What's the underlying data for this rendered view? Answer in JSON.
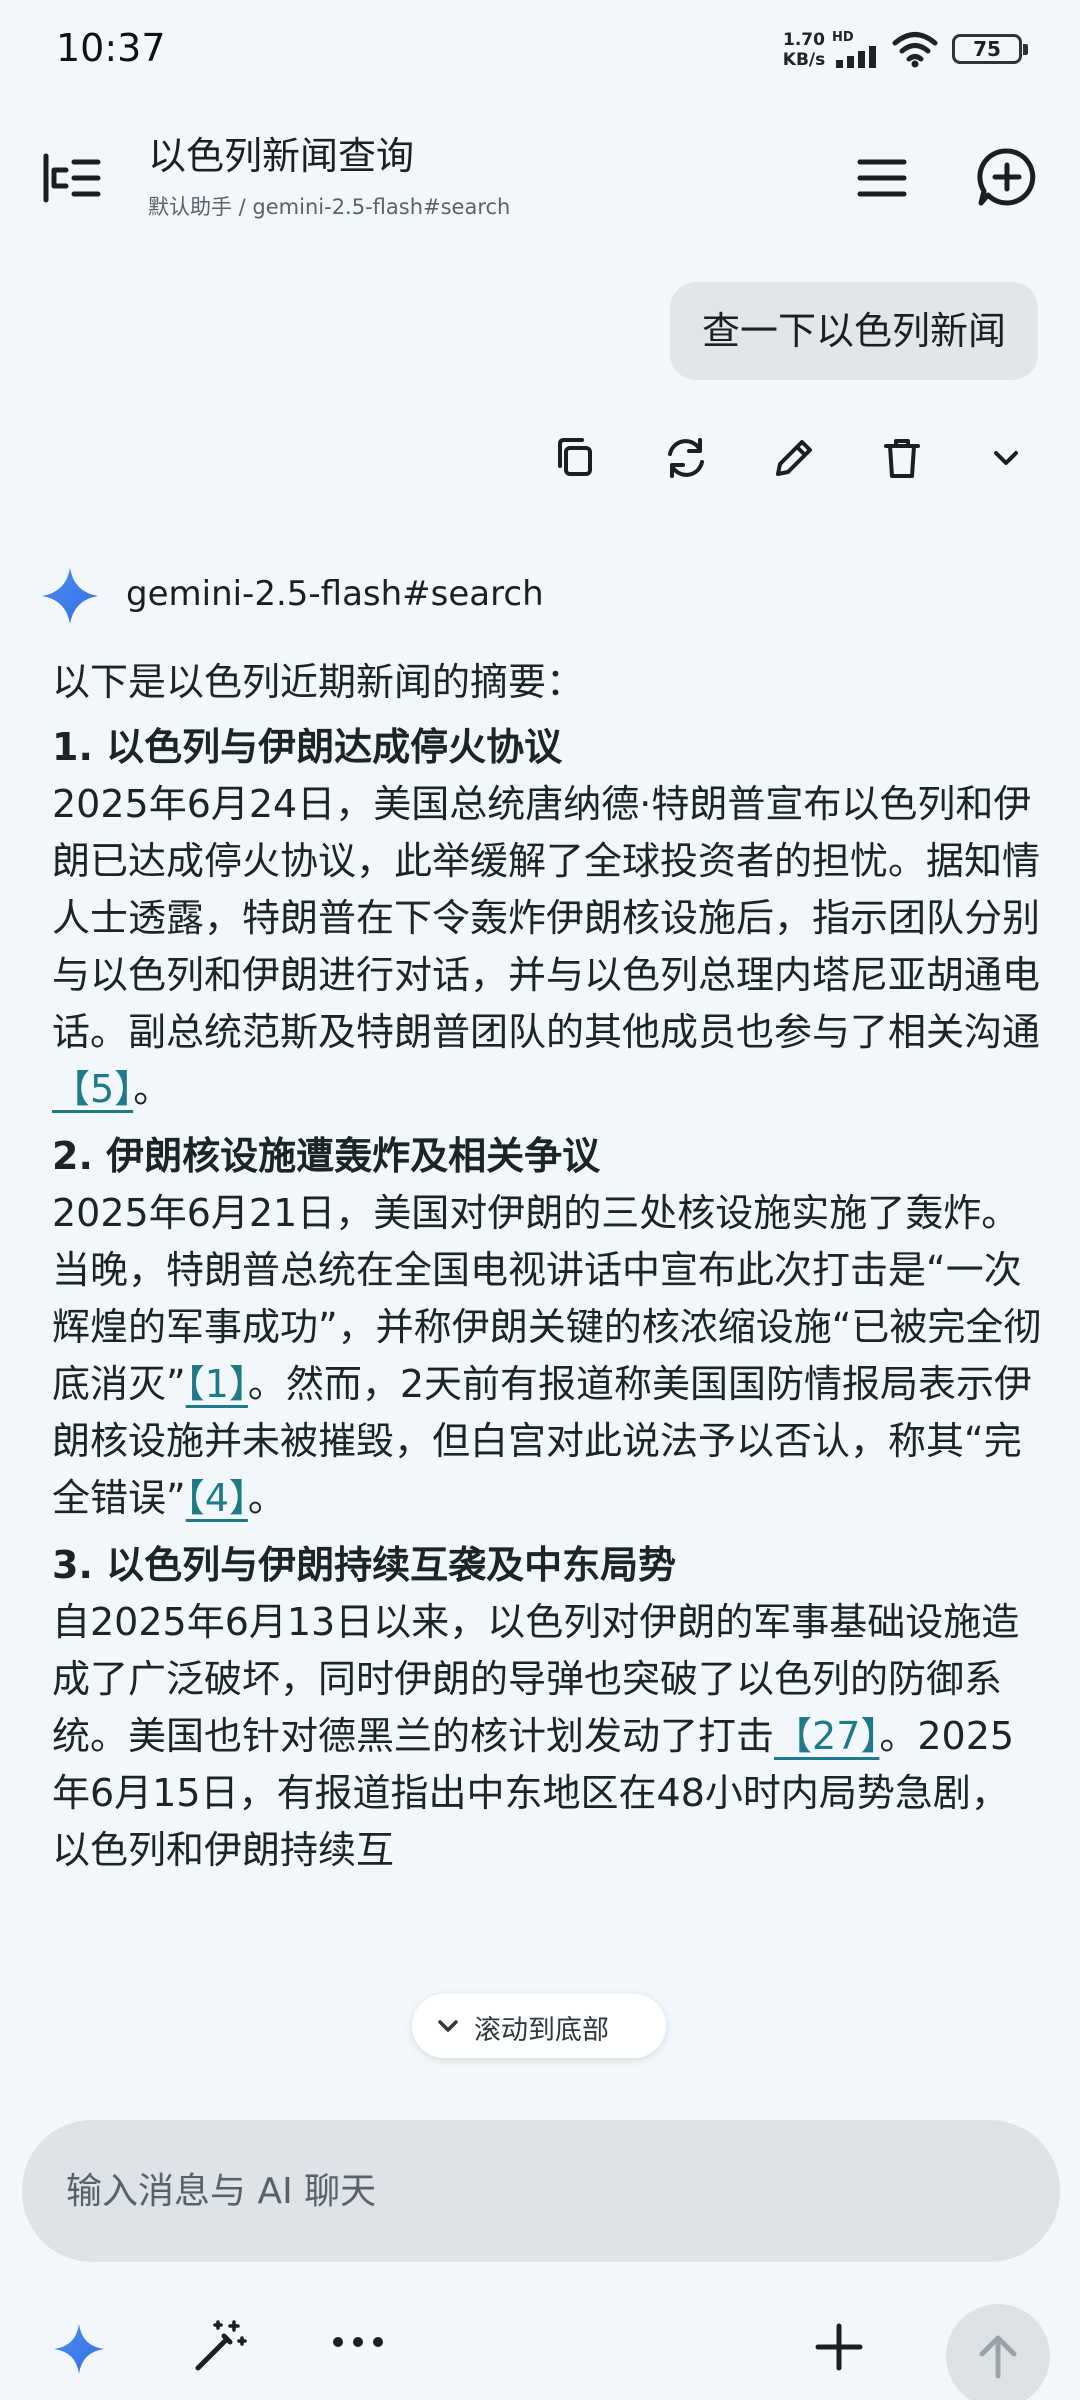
{
  "status_bar": {
    "time": "10:37",
    "net_speed_value": "1.70",
    "net_speed_unit": "KB/s",
    "hd_label": "HD",
    "battery": "75"
  },
  "header": {
    "title": "以色列新闻查询",
    "subtitle": "默认助手 / gemini-2.5-flash#search"
  },
  "user_message": "查一下以色列新闻",
  "model_name": "gemini-2.5-flash#search",
  "response": {
    "intro": "以下是以色列近期新闻的摘要：",
    "sections": [
      {
        "title": "1. 以色列与伊朗达成停火协议",
        "text_a": "2025年6月24日，美国总统唐纳德·特朗普宣布以色列和伊朗已达成停火协议，此举缓解了全球投资者的担忧。据知情人士透露，特朗普在下令轰炸伊朗核设施后，指示团队分别与以色列和伊朗进行对话，并与以色列总理内塔尼亚胡通电话。副总统范斯及特朗普团队的其他成员也参与了相关沟通",
        "cite_a": "【5】",
        "text_b": "。"
      },
      {
        "title": "2. 伊朗核设施遭轰炸及相关争议",
        "text_a": "2025年6月21日，美国对伊朗的三处核设施实施了轰炸。当晚，特朗普总统在全国电视讲话中宣布此次打击是“一次辉煌的军事成功”，并称伊朗关键的核浓缩设施“已被完全彻底消灭”",
        "cite_a": "【1】",
        "text_b": "。然而，2天前有报道称美国国防情报局表示伊朗核设施并未被摧毁，但白宫对此说法予以否认，称其“完全错误”",
        "cite_b": "【4】",
        "text_c": "。"
      },
      {
        "title": "3. 以色列与伊朗持续互袭及中东局势",
        "text_a": "自2025年6月13日以来，以色列对伊朗的军事基础设施造成了广泛破坏，同时伊朗的导弹也突破了以色列的防御系统。美国也针对德黑兰的核计划发动了打击",
        "cite_a": "【27】",
        "text_b": "。2025年6月15日，有报道指出中东地区在48小时内局势急剧，以色列和伊朗持续互"
      }
    ]
  },
  "scroll_to_bottom": "滚动到底部",
  "input": {
    "placeholder": "输入消息与 AI 聊天"
  },
  "colors": {
    "background": "#f1f7fa",
    "user_bubble": "#e2e6e9",
    "citation": "#1d7a86",
    "input": "#dde3e6"
  }
}
